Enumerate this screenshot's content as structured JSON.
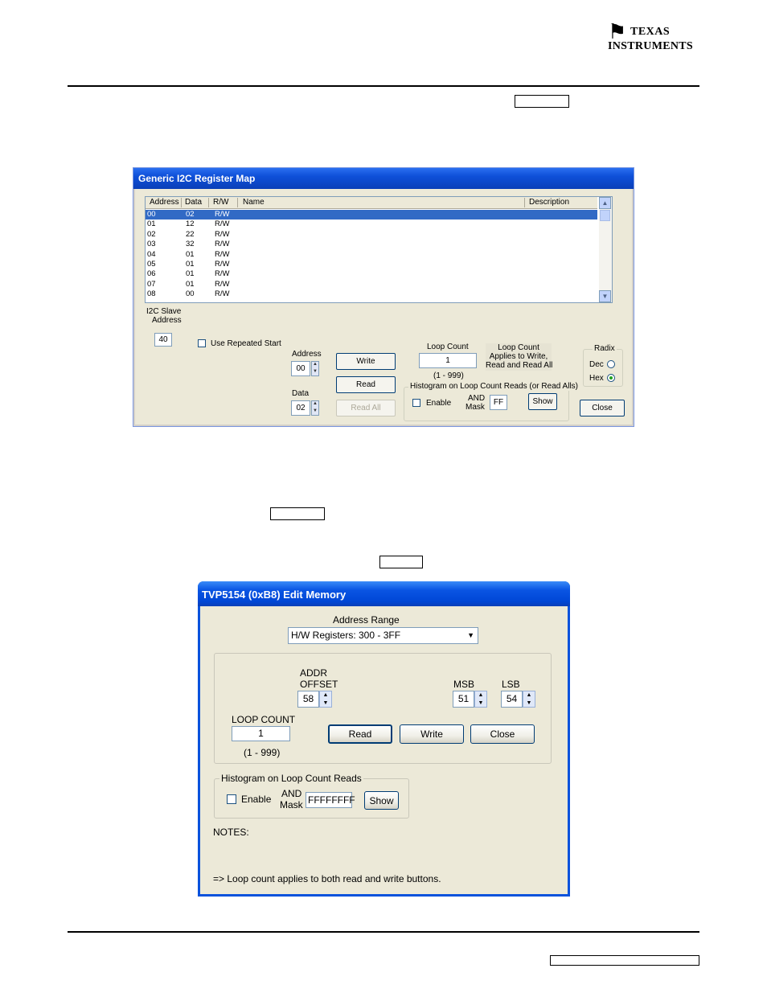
{
  "logo": {
    "line1": "Texas",
    "line2": "Instruments"
  },
  "dialog1": {
    "title": "Generic I2C Register Map",
    "columns": [
      "Address",
      "Data",
      "R/W",
      "Name",
      "Description"
    ],
    "rows": [
      {
        "address": "00",
        "data": "02",
        "rw": "R/W"
      },
      {
        "address": "01",
        "data": "12",
        "rw": "R/W"
      },
      {
        "address": "02",
        "data": "22",
        "rw": "R/W"
      },
      {
        "address": "03",
        "data": "32",
        "rw": "R/W"
      },
      {
        "address": "04",
        "data": "01",
        "rw": "R/W"
      },
      {
        "address": "05",
        "data": "01",
        "rw": "R/W"
      },
      {
        "address": "06",
        "data": "01",
        "rw": "R/W"
      },
      {
        "address": "07",
        "data": "01",
        "rw": "R/W"
      },
      {
        "address": "08",
        "data": "00",
        "rw": "R/W"
      }
    ],
    "slave_label_1": "I2C Slave",
    "slave_label_2": "Address",
    "slave_value": "40",
    "repeated_start": "Use Repeated Start",
    "address_label": "Address",
    "address_value": "00",
    "data_label": "Data",
    "data_value": "02",
    "write": "Write",
    "read": "Read",
    "read_all": "Read All",
    "loop_count_label": "Loop Count",
    "loop_count_value": "1",
    "loop_range": "(1 - 999)",
    "loop_note_1": "Loop Count",
    "loop_note_2": "Applies to Write,",
    "loop_note_3": "Read and Read All",
    "histogram_label": "Histogram on Loop Count Reads (or Read Alls)",
    "enable": "Enable",
    "and_label_1": "AND",
    "and_label_2": "Mask",
    "mask_value": "FF",
    "show": "Show",
    "radix_label": "Radix",
    "dec": "Dec",
    "hex": "Hex",
    "close": "Close"
  },
  "dialog2": {
    "title": "TVP5154 (0xB8) Edit Memory",
    "address_range_label": "Address Range",
    "address_range_value": "H/W Registers: 300 -  3FF",
    "addr_offset_1": "ADDR",
    "addr_offset_2": "OFFSET",
    "addr_offset_value": "58",
    "msb_label": "MSB",
    "msb_value": "51",
    "lsb_label": "LSB",
    "lsb_value": "54",
    "loop_count_label": "LOOP COUNT",
    "loop_count_value": "1",
    "loop_range": "(1 - 999)",
    "read": "Read",
    "write": "Write",
    "close": "Close",
    "histogram_label": "Histogram on Loop Count Reads",
    "enable": "Enable",
    "and_label_1": "AND",
    "and_label_2": "Mask",
    "mask_value": "FFFFFFFF",
    "show": "Show",
    "notes_label": "NOTES:",
    "note_line": "=> Loop count applies to both read and write buttons."
  }
}
